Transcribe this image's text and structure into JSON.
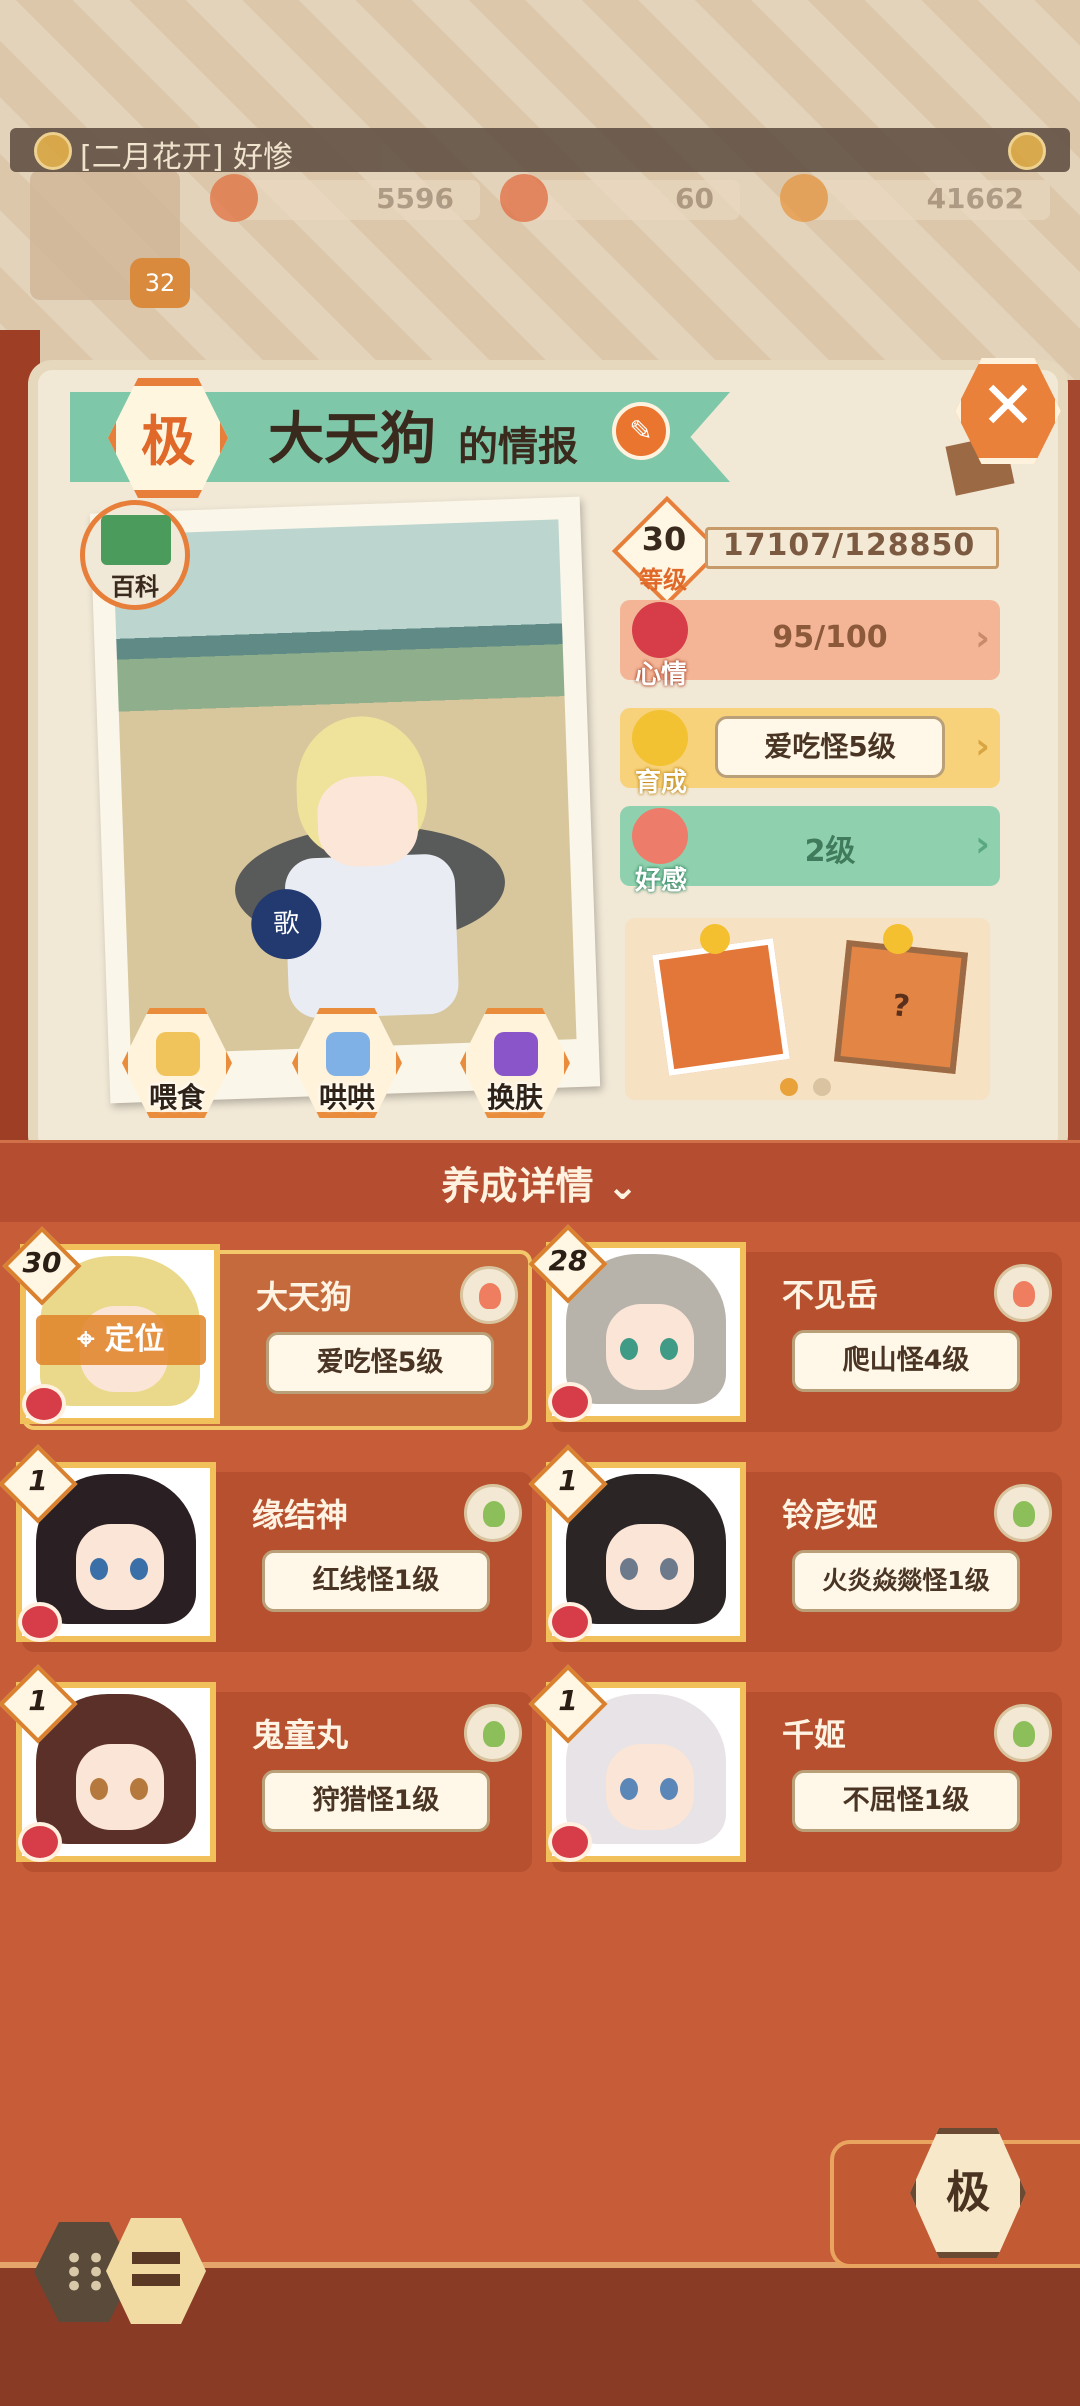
{
  "header": {
    "player_title": "[二月花开] 好惨",
    "player_level": "32",
    "resources": [
      "5596",
      "60",
      "41662"
    ]
  },
  "info": {
    "grade_badge": "极",
    "name": "大天狗",
    "name_suffix": "的情报",
    "encyclopedia_label": "百科",
    "fan_text": "歌",
    "level_label": "等级",
    "level": "30",
    "exp": "17107/128850",
    "mood_label": "心情",
    "mood_value": "95/100",
    "growth_label": "育成",
    "growth_title": "爱吃怪5级",
    "affection_label": "好感",
    "affection_value": "2级",
    "actions": [
      "喂食",
      "哄哄",
      "换肤"
    ],
    "food_hint": "?"
  },
  "nurture": {
    "label": "养成详情 ⌄"
  },
  "cards": [
    {
      "level": "30",
      "name": "大天狗",
      "title": "爱吃怪5级",
      "locate": "定位"
    },
    {
      "level": "28",
      "name": "不见岳",
      "title": "爬山怪4级"
    },
    {
      "level": "1",
      "name": "缘结神",
      "title": "红线怪1级"
    },
    {
      "level": "1",
      "name": "铃彦姬",
      "title": "火炎焱燚怪1级"
    },
    {
      "level": "1",
      "name": "鬼童丸",
      "title": "狩猎怪1级"
    },
    {
      "level": "1",
      "name": "千姬",
      "title": "不屈怪1级"
    }
  ],
  "bottom": {
    "ji_button": "极"
  },
  "colors": {
    "accent_orange": "#e77f3a",
    "mood_bar": "#f3b596",
    "growth_bar": "#f7d27a",
    "affection_bar": "#8fd1ae",
    "list_bg": "#c75c38"
  }
}
